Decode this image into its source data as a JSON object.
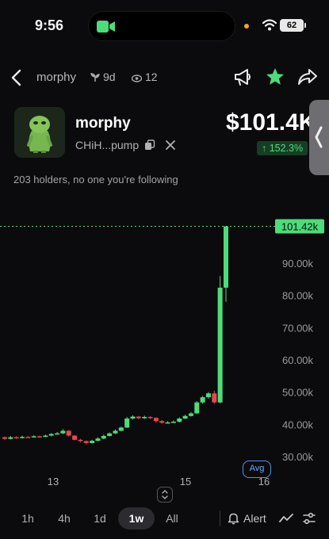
{
  "status_bar": {
    "time": "9:56",
    "battery": "62"
  },
  "nav": {
    "title": "morphy",
    "age": "9d",
    "views": "12"
  },
  "token": {
    "name": "morphy",
    "address": "CHiH...pump",
    "price": "$101.4K",
    "change": "↑ 152.3%"
  },
  "holders_text": "203 holders, no one you're following",
  "chart_data": {
    "type": "candlestick",
    "y_unit": "USD market cap",
    "y_ticks": [
      "90.00k",
      "80.00k",
      "70.00k",
      "60.00k",
      "50.00k",
      "40.00k",
      "30.00k"
    ],
    "y_tick_values": [
      90000,
      80000,
      70000,
      60000,
      50000,
      40000,
      30000
    ],
    "x_ticks": [
      "13",
      "15",
      "16"
    ],
    "current_value": 101420,
    "current_label": "101.42k",
    "candles": [
      [
        36000,
        35500,
        36200,
        35200
      ],
      [
        35500,
        36000,
        36400,
        35300
      ],
      [
        36000,
        35800,
        36300,
        35500
      ],
      [
        35800,
        36100,
        36500,
        35600
      ],
      [
        36100,
        36000,
        36400,
        35800
      ],
      [
        36000,
        36300,
        36600,
        35900
      ],
      [
        36300,
        36100,
        36500,
        35900
      ],
      [
        36100,
        36500,
        36800,
        36000
      ],
      [
        36500,
        37000,
        37300,
        36300
      ],
      [
        37000,
        37200,
        37600,
        36800
      ],
      [
        37200,
        38000,
        38500,
        37000
      ],
      [
        38000,
        36500,
        38200,
        36200
      ],
      [
        36500,
        35200,
        36700,
        35000
      ],
      [
        35200,
        34800,
        35500,
        34500
      ],
      [
        34800,
        34200,
        35000,
        33800
      ],
      [
        34200,
        34900,
        35200,
        34000
      ],
      [
        34900,
        35600,
        36000,
        34700
      ],
      [
        35600,
        36400,
        36800,
        35400
      ],
      [
        36400,
        37200,
        37500,
        36200
      ],
      [
        37200,
        38000,
        38400,
        37000
      ],
      [
        38000,
        39000,
        39300,
        37800
      ],
      [
        39000,
        41800,
        42300,
        38900
      ],
      [
        41800,
        42400,
        42800,
        41500
      ],
      [
        42400,
        41900,
        42600,
        41600
      ],
      [
        41900,
        42300,
        42700,
        41700
      ],
      [
        42300,
        42000,
        42500,
        41700
      ],
      [
        42000,
        41000,
        42200,
        40500
      ],
      [
        41000,
        40500,
        41300,
        40200
      ],
      [
        40500,
        40600,
        41000,
        40200
      ],
      [
        40600,
        40800,
        41200,
        40400
      ],
      [
        40800,
        41800,
        42200,
        40600
      ],
      [
        41800,
        42600,
        43000,
        41600
      ],
      [
        42600,
        43400,
        43800,
        42400
      ],
      [
        43400,
        46800,
        47200,
        43200
      ],
      [
        46800,
        48400,
        48800,
        46400
      ],
      [
        48400,
        49600,
        50000,
        48000
      ],
      [
        49600,
        46800,
        50400,
        46400
      ],
      [
        46800,
        82400,
        86000,
        46500
      ],
      [
        82400,
        101420,
        101420,
        78000
      ]
    ]
  },
  "avg_label": "Avg",
  "timeframes": [
    "1h",
    "4h",
    "1d",
    "1w",
    "All"
  ],
  "selected_timeframe": "1w",
  "alert_label": "Alert",
  "colors": {
    "up": "#4ddc7a",
    "down": "#e5484d",
    "accent": "#4ddc7a",
    "avg": "#4f93f0"
  }
}
